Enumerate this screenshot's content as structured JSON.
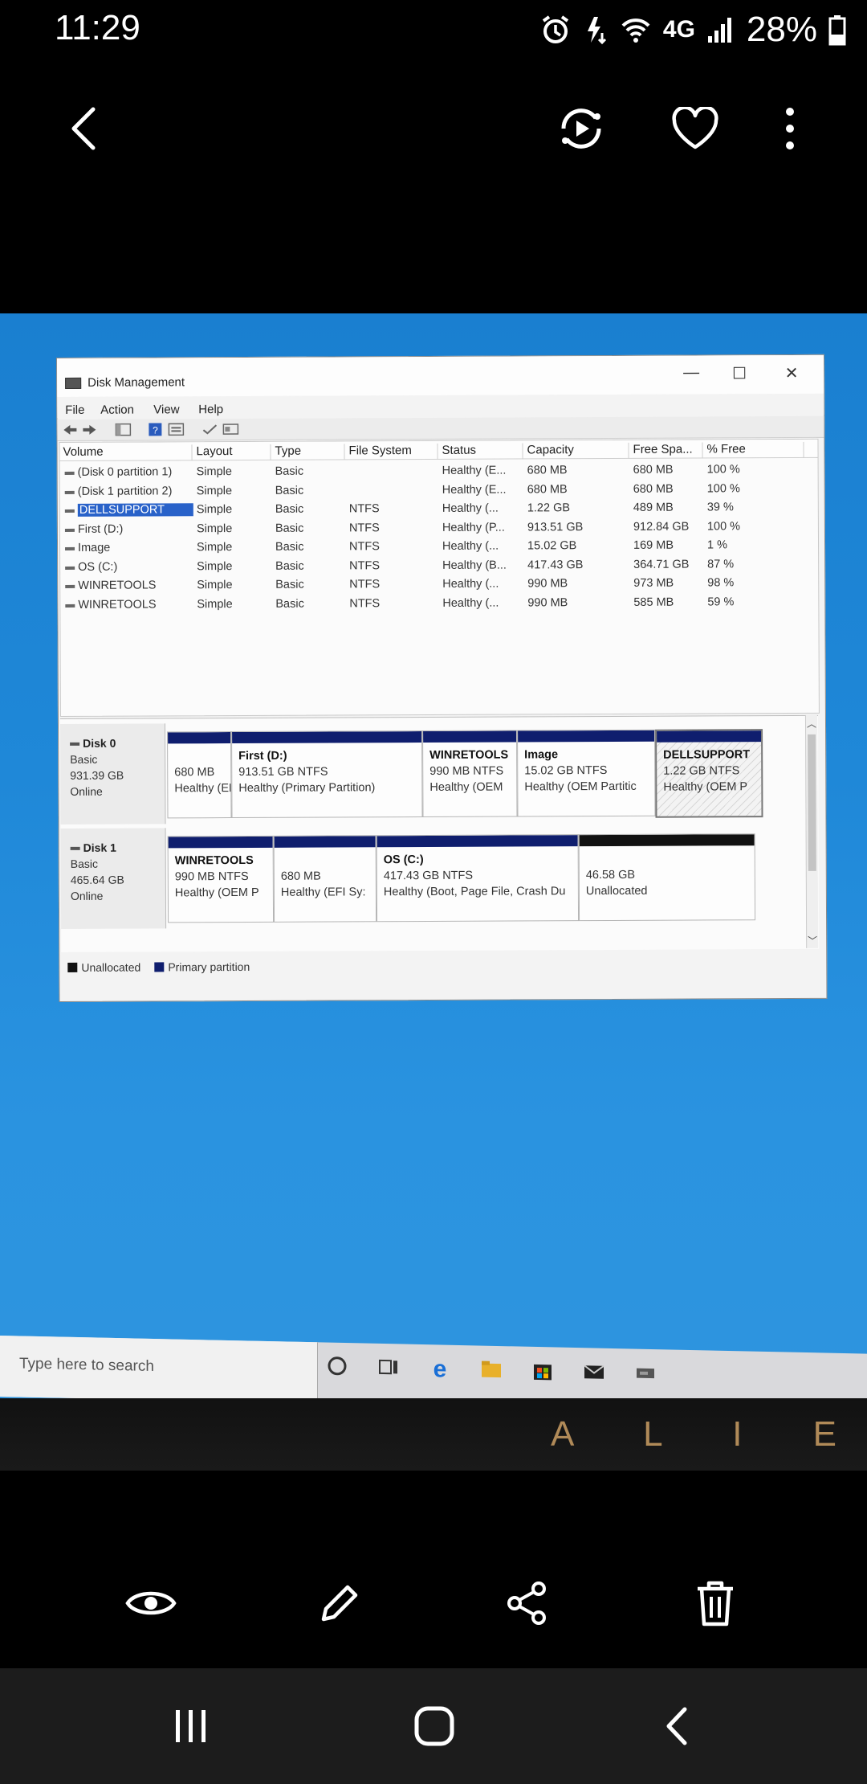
{
  "status_bar": {
    "time": "11:29",
    "network_label": "4G",
    "battery": "28%"
  },
  "viewer": {
    "icons": [
      "back-arrow-icon",
      "motion-photo-icon",
      "heart-icon",
      "more-vert-icon"
    ],
    "actions": [
      "eye-icon",
      "edit-pencil-icon",
      "share-icon",
      "trash-icon"
    ],
    "nav": [
      "recents-icon",
      "home-icon",
      "back-icon"
    ]
  },
  "window": {
    "title": "Disk Management",
    "menu": [
      "File",
      "Action",
      "View",
      "Help"
    ],
    "columns": [
      "Volume",
      "Layout",
      "Type",
      "File System",
      "Status",
      "Capacity",
      "Free Spa...",
      "% Free"
    ],
    "volumes": [
      {
        "volume": "(Disk 0 partition 1)",
        "layout": "Simple",
        "type": "Basic",
        "fs": "",
        "status": "Healthy (E...",
        "capacity": "680 MB",
        "free": "680 MB",
        "pct": "100 %"
      },
      {
        "volume": "(Disk 1 partition 2)",
        "layout": "Simple",
        "type": "Basic",
        "fs": "",
        "status": "Healthy (E...",
        "capacity": "680 MB",
        "free": "680 MB",
        "pct": "100 %"
      },
      {
        "volume": "DELLSUPPORT",
        "layout": "Simple",
        "type": "Basic",
        "fs": "NTFS",
        "status": "Healthy (...",
        "capacity": "1.22 GB",
        "free": "489 MB",
        "pct": "39 %"
      },
      {
        "volume": "First (D:)",
        "layout": "Simple",
        "type": "Basic",
        "fs": "NTFS",
        "status": "Healthy (P...",
        "capacity": "913.51 GB",
        "free": "912.84 GB",
        "pct": "100 %"
      },
      {
        "volume": "Image",
        "layout": "Simple",
        "type": "Basic",
        "fs": "NTFS",
        "status": "Healthy (...",
        "capacity": "15.02 GB",
        "free": "169 MB",
        "pct": "1 %"
      },
      {
        "volume": "OS (C:)",
        "layout": "Simple",
        "type": "Basic",
        "fs": "NTFS",
        "status": "Healthy (B...",
        "capacity": "417.43 GB",
        "free": "364.71 GB",
        "pct": "87 %"
      },
      {
        "volume": "WINRETOOLS",
        "layout": "Simple",
        "type": "Basic",
        "fs": "NTFS",
        "status": "Healthy (...",
        "capacity": "990 MB",
        "free": "973 MB",
        "pct": "98 %"
      },
      {
        "volume": "WINRETOOLS",
        "layout": "Simple",
        "type": "Basic",
        "fs": "NTFS",
        "status": "Healthy (...",
        "capacity": "990 MB",
        "free": "585 MB",
        "pct": "59 %"
      }
    ],
    "disks": [
      {
        "name": "Disk 0",
        "type": "Basic",
        "size": "931.39 GB",
        "state": "Online",
        "partitions": [
          {
            "name": "",
            "size": "680 MB",
            "status": "Healthy (EFI S"
          },
          {
            "name": "First  (D:)",
            "size": "913.51 GB NTFS",
            "status": "Healthy (Primary Partition)"
          },
          {
            "name": "WINRETOOLS",
            "size": "990 MB NTFS",
            "status": "Healthy (OEM"
          },
          {
            "name": "Image",
            "size": "15.02 GB NTFS",
            "status": "Healthy (OEM Partitic"
          },
          {
            "name": "DELLSUPPORT",
            "size": "1.22 GB NTFS",
            "status": "Healthy (OEM P"
          }
        ]
      },
      {
        "name": "Disk 1",
        "type": "Basic",
        "size": "465.64 GB",
        "state": "Online",
        "partitions": [
          {
            "name": "WINRETOOLS",
            "size": "990 MB NTFS",
            "status": "Healthy (OEM P"
          },
          {
            "name": "",
            "size": "680 MB",
            "status": "Healthy (EFI Sy:"
          },
          {
            "name": "OS  (C:)",
            "size": "417.43 GB NTFS",
            "status": "Healthy (Boot, Page File, Crash Du"
          },
          {
            "name": "",
            "size": "46.58 GB",
            "status": "Unallocated"
          }
        ]
      }
    ],
    "legend": {
      "unallocated": "Unallocated",
      "primary": "Primary partition"
    },
    "colors": {
      "primary_bar": "#0f1e6e",
      "unallocated_bar": "#111111",
      "selection": "#2962c9"
    }
  },
  "taskbar": {
    "search_placeholder": "Type here to search"
  },
  "monitor_brand": "A L I E"
}
